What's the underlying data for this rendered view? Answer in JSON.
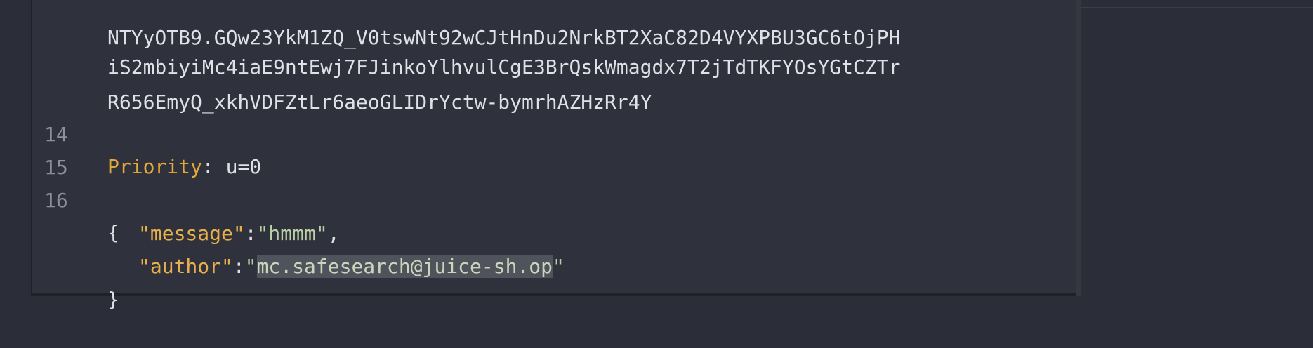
{
  "editor": {
    "wrapped_lines": [
      "NTYyOTB9.GQw23YkM1ZQ_V0tswNt92wCJtHnDu2NrkBT2XaC82D4VYXPBU3GC6tOjPH",
      "iS2mbiyiMc4iaE9ntEwj7FJinkoYlhvulCgE3BrQskWmagdx7T2jTdTKFYOsYGtCZTr",
      "R656EmyQ_xkhVDFZtLr6aeoGLIDrYctw-bymrhAZHzRr4Y"
    ],
    "line14": {
      "number": "14",
      "header_name": "Priority",
      "separator": ": ",
      "header_value": "u=0"
    },
    "line15": {
      "number": "15"
    },
    "line16": {
      "number": "16",
      "open_brace": "{"
    },
    "json_body": {
      "message_key": "\"message\"",
      "message_colon": ":",
      "message_value": "\"hmmm\"",
      "message_comma": ",",
      "author_key": "\"author\"",
      "author_colon": ":",
      "author_quote_open": "\"",
      "author_value_selected": "mc.safesearch@juice-sh.op",
      "author_quote_close": "\"",
      "close_brace": "}"
    }
  }
}
